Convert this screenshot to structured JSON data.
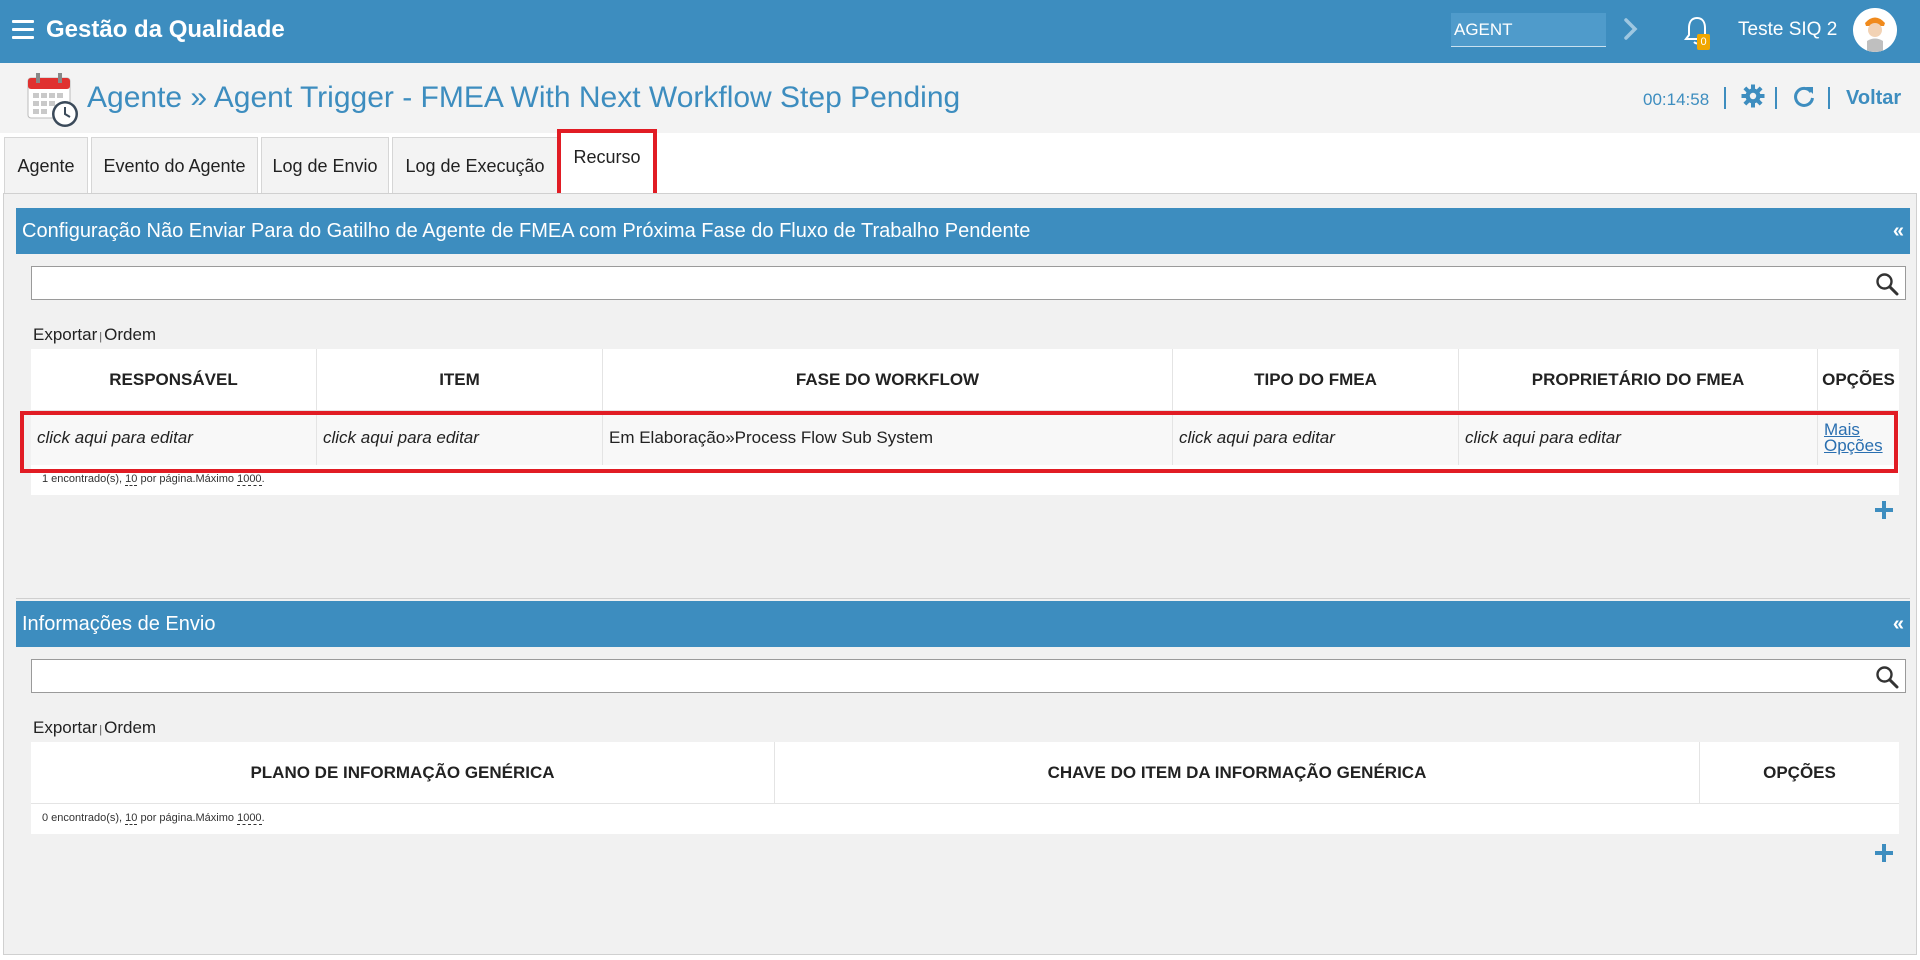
{
  "topbar": {
    "app_title": "Gestão da Qualidade",
    "agent_field_value": "AGENT",
    "notification_count": "0",
    "user_name": "Teste SIQ 2"
  },
  "header": {
    "title": "Agente » Agent Trigger - FMEA With Next Workflow Step Pending",
    "timer": "00:14:58",
    "back_label": "Voltar"
  },
  "tabs": [
    {
      "label": "Agente",
      "active": false
    },
    {
      "label": "Evento do Agente",
      "active": false
    },
    {
      "label": "Log de Envio",
      "active": false
    },
    {
      "label": "Log de Execução",
      "active": false
    },
    {
      "label": "Recurso",
      "active": true
    }
  ],
  "panel1": {
    "title": "Configuração Não Enviar Para do Gatilho de Agente de FMEA com Próxima Fase do Fluxo de Trabalho Pendente",
    "collapse": "«",
    "search_value": "",
    "export_label": "Exportar",
    "pipe": "|",
    "order_label": "Ordem",
    "columns": [
      "RESPONSÁVEL",
      "ITEM",
      "FASE DO WORKFLOW",
      "TIPO DO FMEA",
      "PROPRIETÁRIO DO FMEA",
      "OPÇÕES"
    ],
    "rows": [
      {
        "responsavel": "click aqui para editar",
        "item": "click aqui para editar",
        "fase": "Em Elaboração»Process Flow Sub System",
        "tipo": "click aqui para editar",
        "proprietario": "click aqui para editar",
        "options_line1": "Mais",
        "options_line2": "Opções"
      }
    ],
    "pager": {
      "found": "1 encontrado(s), ",
      "per_page": "10",
      "per_page_suffix": " por página.Máximo ",
      "max": "1000",
      "end": "."
    }
  },
  "panel2": {
    "title": "Informações de Envio",
    "collapse": "«",
    "search_value": "",
    "export_label": "Exportar",
    "pipe": "|",
    "order_label": "Ordem",
    "columns": [
      "PLANO DE INFORMAÇÃO GENÉRICA",
      "CHAVE DO ITEM DA INFORMAÇÃO GENÉRICA",
      "OPÇÕES"
    ],
    "pager": {
      "found": "0 encontrado(s), ",
      "per_page": "10",
      "per_page_suffix": " por página.Máximo ",
      "max": "1000",
      "end": "."
    }
  },
  "colors": {
    "brand_blue": "#3d8dbf",
    "highlight_red": "#e11c24",
    "badge_orange": "#f0a700"
  }
}
